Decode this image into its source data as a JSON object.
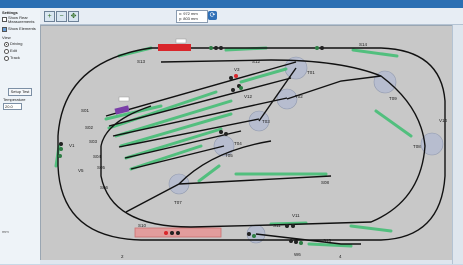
{
  "left_panel": {
    "settings_title": "Settings",
    "options": [
      {
        "label": "Show Rear Measurements",
        "checked": false
      },
      {
        "label": "Show Elements",
        "checked": true
      }
    ],
    "view_label": "View",
    "view_options": [
      {
        "label": "Driving",
        "selected": true
      },
      {
        "label": "Edit",
        "selected": false
      },
      {
        "label": "Track",
        "selected": false
      }
    ],
    "setup_button": "Setup Test",
    "temperature_label": "Temperature",
    "temperature_value": "20.0"
  },
  "toolbar": {
    "coord_x": "x: 972 mm",
    "coord_y": "y: 803 mm",
    "y_unit": "mm"
  },
  "track_labels": {
    "s13": "S13",
    "s14": "S14",
    "s15": "S15",
    "s12": "S12",
    "s01": "S01",
    "s02": "S02",
    "s03": "S03",
    "s04": "S04",
    "s05": "S05",
    "s06": "S06",
    "s07": "S07",
    "s08": "S08",
    "s10": "S10",
    "s11": "S11",
    "s16": "S16",
    "t01": "T01",
    "t02": "T02",
    "t03": "T03",
    "t04": "T04",
    "t05": "T05",
    "t06": "T06",
    "t07": "T07",
    "t08": "T08",
    "t09": "T09",
    "v1": "V1",
    "v2": "V2",
    "v3": "V3",
    "v4": "V4",
    "v5": "V5",
    "v11": "V11",
    "v12": "V12",
    "v14": "V14",
    "w1": "W1",
    "w2": "W2",
    "w3": "W3",
    "w4": "W4",
    "w5": "W5",
    "w6": "W6"
  },
  "axis": {
    "bottom_left": "2",
    "bottom_right": "4",
    "y_marker": "1.0"
  },
  "colors": {
    "track": "#111111",
    "sensor_green": "#3cb36a",
    "train_red": "#d9262b",
    "train_purple": "#7a3ea8",
    "turnout": "#b8bfd0",
    "highlight_red": "#e98a8a"
  }
}
